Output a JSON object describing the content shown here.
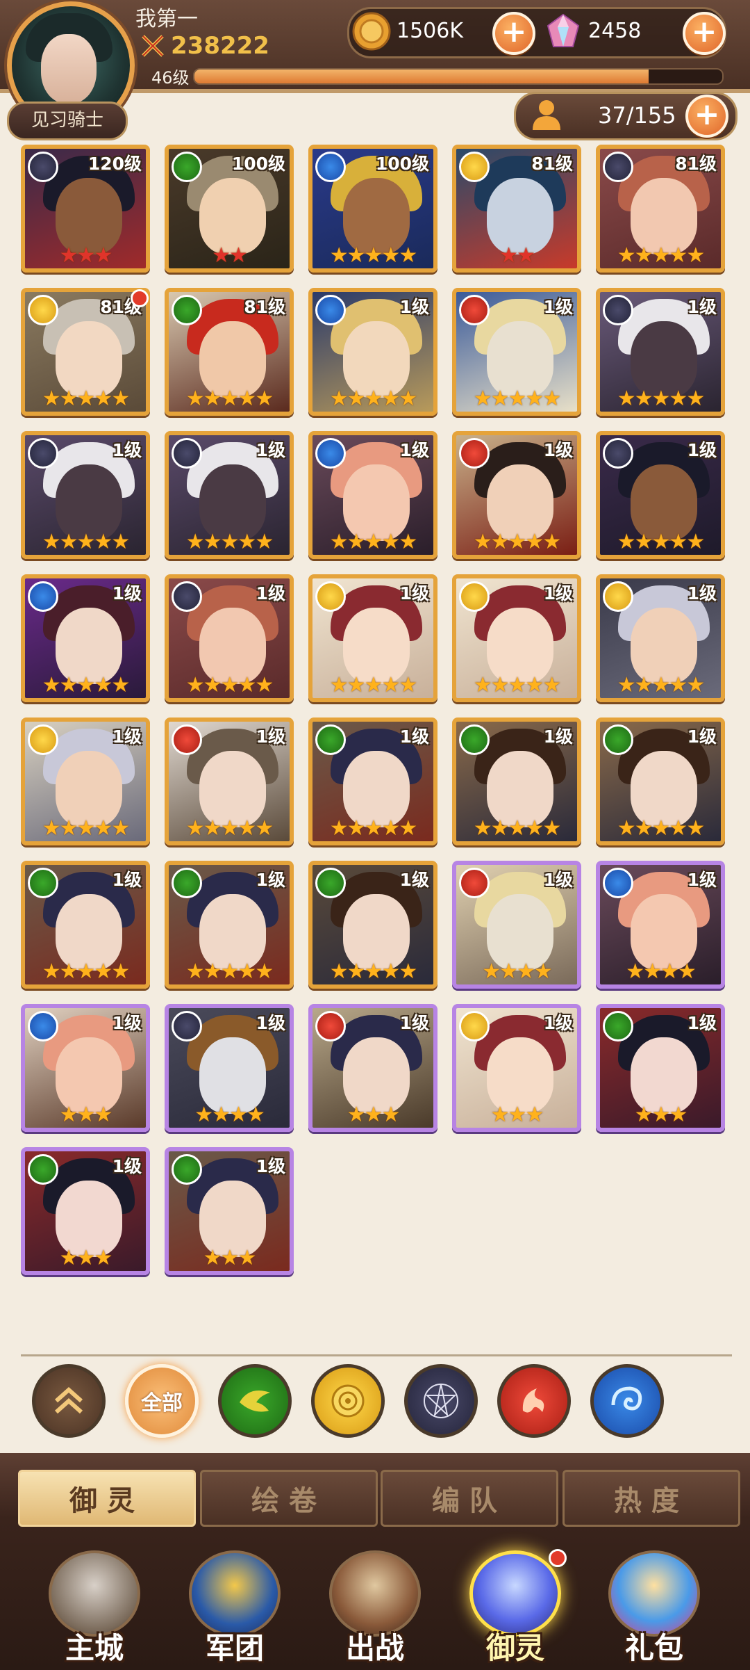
{
  "player": {
    "name": "我第一",
    "power": "238222",
    "level_label": "46级",
    "xp_fraction": 0.86,
    "rank": "见习骑士"
  },
  "resources": {
    "gold": "1506K",
    "gems": "2458"
  },
  "hero_count": "37/155",
  "colors": {
    "gold_border": "#e5a33a",
    "purple_border": "#b784e4",
    "star_gold": "#ffb21c",
    "star_red": "#e0342a",
    "nature": "#2c8a1e",
    "light": "#e8b020",
    "dark": "#3a3a5a",
    "fire": "#c8301e",
    "water": "#1e64c8"
  },
  "heroes": [
    {
      "level": "120级",
      "faction": "dark",
      "stars": "★★★",
      "star_color": "red",
      "frame": "gold",
      "skin": "#8a5a3a",
      "hair": "#1a1a2a",
      "bg1": "#3a2a4a",
      "bg2": "#a02a2a"
    },
    {
      "level": "100级",
      "faction": "nature",
      "stars": "★★",
      "star_color": "red",
      "frame": "gold",
      "skin": "#f0d0b0",
      "hair": "#9a8a70",
      "bg1": "#4a3a2a",
      "bg2": "#2a2418"
    },
    {
      "level": "100级",
      "faction": "water",
      "stars": "★★★★★",
      "star_color": "gold",
      "frame": "gold",
      "skin": "#a06a42",
      "hair": "#d8b03a",
      "bg1": "#2a3a8a",
      "bg2": "#1a2a5a"
    },
    {
      "level": "81级",
      "faction": "light",
      "stars": "★★",
      "star_color": "red",
      "frame": "gold",
      "skin": "#c8d2e0",
      "hair": "#1e3a5a",
      "bg1": "#2a4a6a",
      "bg2": "#c83a2a"
    },
    {
      "level": "81级",
      "faction": "dark",
      "stars": "★★★★★",
      "star_color": "gold",
      "frame": "gold",
      "skin": "#f2c8b0",
      "hair": "#b8624a",
      "bg1": "#8a4a4a",
      "bg2": "#5a2a2a"
    },
    {
      "level": "81级",
      "faction": "light",
      "stars": "★★★★★",
      "star_color": "gold",
      "frame": "gold",
      "skin": "#f2d8c2",
      "hair": "#c8c0b4",
      "bg1": "#8a7a60",
      "bg2": "#5a4a38",
      "dot": true
    },
    {
      "level": "81级",
      "faction": "nature",
      "stars": "★★★★★",
      "star_color": "gold",
      "frame": "gold",
      "skin": "#f0c8a8",
      "hair": "#c82a1e",
      "bg1": "#d8c8b0",
      "bg2": "#5a2a1e"
    },
    {
      "level": "1级",
      "faction": "water",
      "stars": "★★★★★",
      "star_color": "gold",
      "frame": "gold",
      "skin": "#f2d8bc",
      "hair": "#e0c070",
      "bg1": "#2a3a6a",
      "bg2": "#b89a5a"
    },
    {
      "level": "1级",
      "faction": "fire",
      "stars": "★★★★★",
      "star_color": "gold",
      "frame": "gold",
      "skin": "#e8e0d0",
      "hair": "#e8d8a0",
      "bg1": "#3a5a9a",
      "bg2": "#e8e0c8"
    },
    {
      "level": "1级",
      "faction": "dark",
      "stars": "★★★★★",
      "star_color": "gold",
      "frame": "gold",
      "skin": "#4a3a44",
      "hair": "#e8e6ea",
      "bg1": "#6a5a7a",
      "bg2": "#2a2430"
    },
    {
      "level": "1级",
      "faction": "dark",
      "stars": "★★★★★",
      "star_color": "gold",
      "frame": "gold",
      "skin": "#4a3a44",
      "hair": "#e8e6ea",
      "bg1": "#5a4a6a",
      "bg2": "#2a2430"
    },
    {
      "level": "1级",
      "faction": "dark",
      "stars": "★★★★★",
      "star_color": "gold",
      "frame": "gold",
      "skin": "#4a3a44",
      "hair": "#e8e6ea",
      "bg1": "#5a4a6a",
      "bg2": "#2a2430"
    },
    {
      "level": "1级",
      "faction": "water",
      "stars": "★★★★★",
      "star_color": "gold",
      "frame": "gold",
      "skin": "#f4c8b0",
      "hair": "#e89a80",
      "bg1": "#6a4a5a",
      "bg2": "#2a1e2a"
    },
    {
      "level": "1级",
      "faction": "fire",
      "stars": "★★★★★",
      "star_color": "gold",
      "frame": "gold",
      "skin": "#f0d0b8",
      "hair": "#2a1e1a",
      "bg1": "#c8b08a",
      "bg2": "#7a1e14"
    },
    {
      "level": "1级",
      "faction": "dark",
      "stars": "★★★★★",
      "star_color": "gold",
      "frame": "gold",
      "skin": "#8a5a3a",
      "hair": "#1a1a2a",
      "bg1": "#3a2a4a",
      "bg2": "#1e1a2a"
    },
    {
      "level": "1级",
      "faction": "water",
      "stars": "★★★★★",
      "star_color": "gold",
      "frame": "gold",
      "skin": "#f0d8c8",
      "hair": "#4a1e2a",
      "bg1": "#6a2a8a",
      "bg2": "#2a1a3a"
    },
    {
      "level": "1级",
      "faction": "dark",
      "stars": "★★★★★",
      "star_color": "gold",
      "frame": "gold",
      "skin": "#f2c8b0",
      "hair": "#b8624a",
      "bg1": "#8a4a4a",
      "bg2": "#5a2a2a"
    },
    {
      "level": "1级",
      "faction": "light",
      "stars": "★★★★★",
      "star_color": "gold",
      "frame": "gold",
      "skin": "#f6dcc8",
      "hair": "#8a2a30",
      "bg1": "#f0e4d0",
      "bg2": "#c8b09a"
    },
    {
      "level": "1级",
      "faction": "light",
      "stars": "★★★★★",
      "star_color": "gold",
      "frame": "gold",
      "skin": "#f6dcc8",
      "hair": "#8a2a30",
      "bg1": "#f0e4d0",
      "bg2": "#c8b09a"
    },
    {
      "level": "1级",
      "faction": "light",
      "stars": "★★★★★",
      "star_color": "gold",
      "frame": "gold",
      "skin": "#f0d0b8",
      "hair": "#c8c8d8",
      "bg1": "#3a3a4a",
      "bg2": "#6a6a7a"
    },
    {
      "level": "1级",
      "faction": "light",
      "stars": "★★★★★",
      "star_color": "gold",
      "frame": "gold",
      "skin": "#f0d0b8",
      "hair": "#c8c8d8",
      "bg1": "#d8d0c0",
      "bg2": "#6a6a7a"
    },
    {
      "level": "1级",
      "faction": "fire",
      "stars": "★★★★★",
      "star_color": "gold",
      "frame": "gold",
      "skin": "#f0d8c8",
      "hair": "#6a5a4a",
      "bg1": "#e0d8d0",
      "bg2": "#5a4a3a"
    },
    {
      "level": "1级",
      "faction": "nature",
      "stars": "★★★★★",
      "star_color": "gold",
      "frame": "gold",
      "skin": "#f0d8c8",
      "hair": "#2a2a4a",
      "bg1": "#6a5a4a",
      "bg2": "#7a2a1e"
    },
    {
      "level": "1级",
      "faction": "nature",
      "stars": "★★★★★",
      "star_color": "gold",
      "frame": "gold",
      "skin": "#f0d8c8",
      "hair": "#3a2418",
      "bg1": "#8a6a4a",
      "bg2": "#2a2a3a"
    },
    {
      "level": "1级",
      "faction": "nature",
      "stars": "★★★★★",
      "star_color": "gold",
      "frame": "gold",
      "skin": "#f0d8c8",
      "hair": "#3a2418",
      "bg1": "#8a6a4a",
      "bg2": "#2a2a3a"
    },
    {
      "level": "1级",
      "faction": "nature",
      "stars": "★★★★★",
      "star_color": "gold",
      "frame": "gold",
      "skin": "#f0d8c8",
      "hair": "#2a2a4a",
      "bg1": "#6a5a4a",
      "bg2": "#7a2a1e"
    },
    {
      "level": "1级",
      "faction": "nature",
      "stars": "★★★★★",
      "star_color": "gold",
      "frame": "gold",
      "skin": "#f0d8c8",
      "hair": "#2a2a4a",
      "bg1": "#6a5a4a",
      "bg2": "#7a2a1e"
    },
    {
      "level": "1级",
      "faction": "nature",
      "stars": "★★★★★",
      "star_color": "gold",
      "frame": "gold",
      "skin": "#f0d8c8",
      "hair": "#3a2418",
      "bg1": "#5a4a3a",
      "bg2": "#2a2a3a"
    },
    {
      "level": "1级",
      "faction": "fire",
      "stars": "★★★★",
      "star_color": "gold",
      "frame": "purple",
      "skin": "#e8e0d0",
      "hair": "#e8d8a0",
      "bg1": "#e0d0b0",
      "bg2": "#7a6a5a"
    },
    {
      "level": "1级",
      "faction": "water",
      "stars": "★★★★",
      "star_color": "gold",
      "frame": "purple",
      "skin": "#f4c8b0",
      "hair": "#e89a80",
      "bg1": "#6a4a5a",
      "bg2": "#2a1e2a"
    },
    {
      "level": "1级",
      "faction": "water",
      "stars": "★★★",
      "star_color": "gold",
      "frame": "purple",
      "skin": "#f4c8b0",
      "hair": "#e89a80",
      "bg1": "#e0d0c0",
      "bg2": "#5a3a2a"
    },
    {
      "level": "1级",
      "faction": "dark",
      "stars": "★★★★",
      "star_color": "gold",
      "frame": "purple",
      "skin": "#e0e0e4",
      "hair": "#8a5a2a",
      "bg1": "#4a4a5a",
      "bg2": "#2a2a3a"
    },
    {
      "level": "1级",
      "faction": "fire",
      "stars": "★★★",
      "star_color": "gold",
      "frame": "purple",
      "skin": "#f0d8c8",
      "hair": "#2a2a4a",
      "bg1": "#b8a88a",
      "bg2": "#4a3a2a"
    },
    {
      "level": "1级",
      "faction": "light",
      "stars": "★★★",
      "star_color": "gold",
      "frame": "purple",
      "skin": "#f6dcc8",
      "hair": "#8a2a30",
      "bg1": "#f0e4d0",
      "bg2": "#c8b09a"
    },
    {
      "level": "1级",
      "faction": "nature",
      "stars": "★★★",
      "star_color": "gold",
      "frame": "purple",
      "skin": "#f2d8d0",
      "hair": "#1a1a2a",
      "bg1": "#8a2a2a",
      "bg2": "#3a1a2a"
    },
    {
      "level": "1级",
      "faction": "nature",
      "stars": "★★★",
      "star_color": "gold",
      "frame": "purple",
      "skin": "#f2d8d0",
      "hair": "#1a1a2a",
      "bg1": "#8a2a2a",
      "bg2": "#3a1a2a"
    },
    {
      "level": "1级",
      "faction": "nature",
      "stars": "★★★",
      "star_color": "gold",
      "frame": "purple",
      "skin": "#f0d8c8",
      "hair": "#2a2a4a",
      "bg1": "#6a5a4a",
      "bg2": "#7a2a1e"
    }
  ],
  "filters": {
    "all_label": "全部",
    "factions": [
      "nature",
      "light",
      "dark",
      "fire",
      "water"
    ]
  },
  "tabs": [
    {
      "label": "御灵",
      "active": true
    },
    {
      "label": "绘卷",
      "active": false
    },
    {
      "label": "编队",
      "active": false
    },
    {
      "label": "热度",
      "active": false
    }
  ],
  "nav": [
    {
      "label": "主城",
      "icon": "castle-icon",
      "active": false
    },
    {
      "label": "军团",
      "icon": "legion-shield-icon",
      "active": false
    },
    {
      "label": "出战",
      "icon": "battle-gate-icon",
      "active": false
    },
    {
      "label": "御灵",
      "icon": "crystal-icon",
      "active": true
    },
    {
      "label": "礼包",
      "icon": "gift-shop-icon",
      "active": false
    }
  ]
}
